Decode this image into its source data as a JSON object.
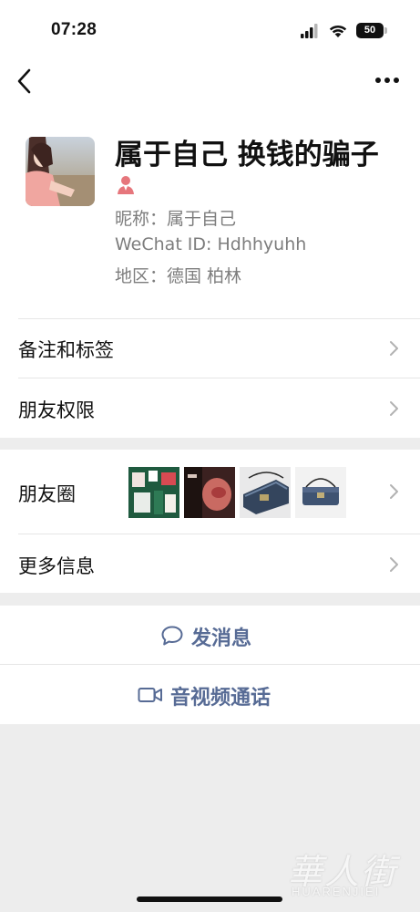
{
  "status_bar": {
    "time": "07:28",
    "battery": "50"
  },
  "profile": {
    "name": "属于自己 换钱的骗子",
    "nickname": "昵称：属于自己",
    "wechat_id": "WeChat ID: Hdhhyuhh",
    "region": "地区：德国 柏林",
    "gender_icon": "female-person-icon",
    "gender_color": "#e6767c"
  },
  "rows": {
    "remarks_tags": "备注和标签",
    "friend_permissions": "朋友权限",
    "moments": "朋友圈",
    "more_info": "更多信息"
  },
  "actions": {
    "send_message": "发消息",
    "video_call": "音视频通话"
  },
  "watermark": {
    "cn": "華人街",
    "en": "HUARENJIEI"
  },
  "colors": {
    "link_blue": "#576b95",
    "background_gray": "#ededed",
    "chevron_gray": "#b2b2b2"
  }
}
